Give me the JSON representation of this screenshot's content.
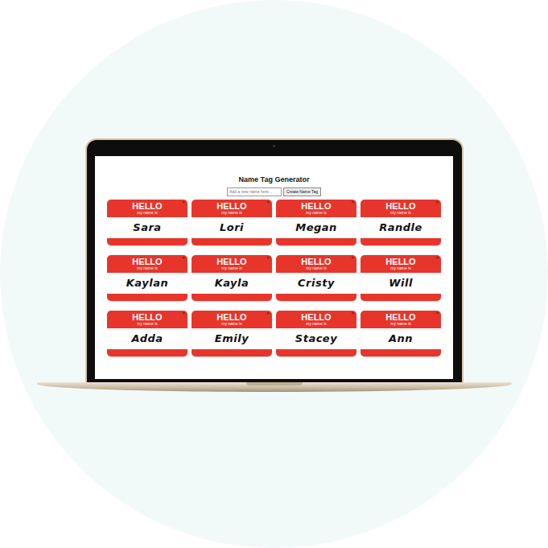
{
  "window": {
    "title": "Name Tag Generator"
  },
  "form": {
    "placeholder": "Add a new name here...",
    "button": "Create Name Tag"
  },
  "tag": {
    "greeting": "HELLO",
    "subtitle": "my name is",
    "delete": "×"
  },
  "tags": [
    {
      "name": "Sara"
    },
    {
      "name": "Lori"
    },
    {
      "name": "Megan"
    },
    {
      "name": "Randle"
    },
    {
      "name": "Kaylan"
    },
    {
      "name": "Kayla"
    },
    {
      "name": "Cristy"
    },
    {
      "name": "Will"
    },
    {
      "name": "Adda"
    },
    {
      "name": "Emily"
    },
    {
      "name": "Stacey"
    },
    {
      "name": "Ann"
    }
  ]
}
